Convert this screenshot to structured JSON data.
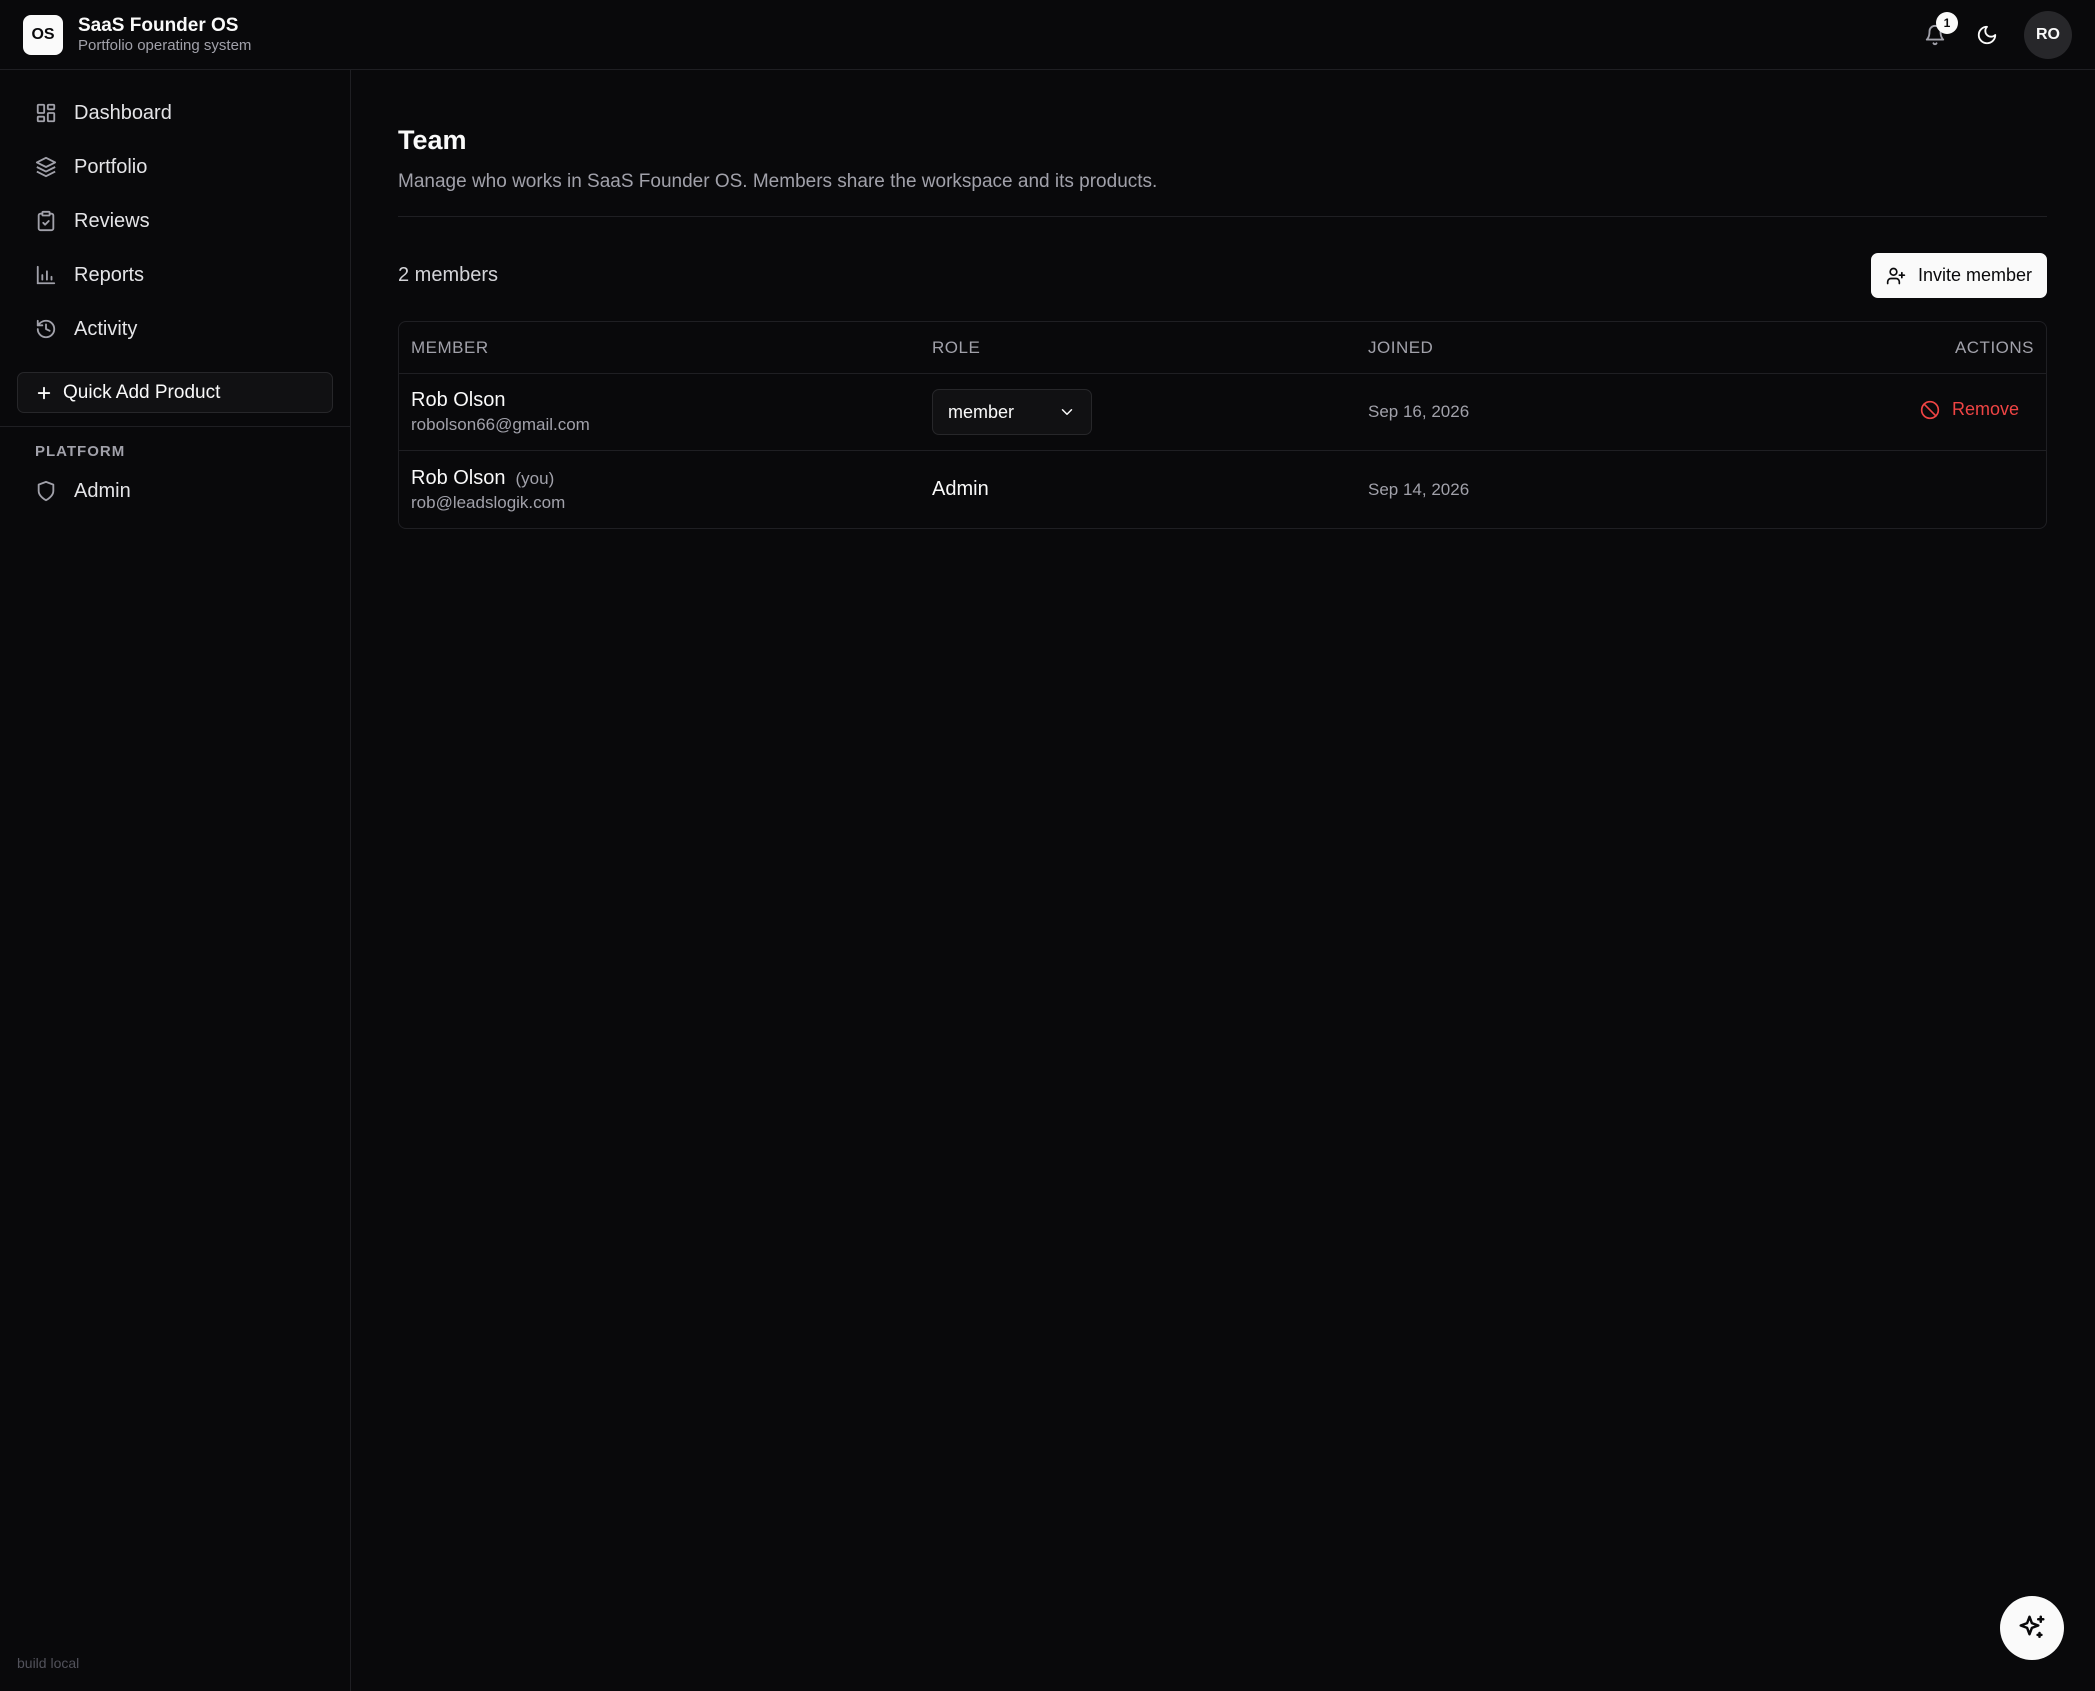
{
  "app": {
    "logo_text": "OS",
    "name": "SaaS Founder OS",
    "subtitle": "Portfolio operating system"
  },
  "header": {
    "notification_count": "1",
    "avatar_initials": "RO"
  },
  "sidebar": {
    "items": [
      {
        "label": "Dashboard",
        "icon": "dashboard-icon"
      },
      {
        "label": "Portfolio",
        "icon": "layers-icon"
      },
      {
        "label": "Reviews",
        "icon": "clipboard-check-icon"
      },
      {
        "label": "Reports",
        "icon": "bar-chart-icon"
      },
      {
        "label": "Activity",
        "icon": "history-icon"
      }
    ],
    "quick_add_label": "Quick Add Product",
    "section_label": "PLATFORM",
    "platform_items": [
      {
        "label": "Admin",
        "icon": "shield-icon"
      }
    ],
    "build_label": "build local"
  },
  "main": {
    "title": "Team",
    "description": "Manage who works in SaaS Founder OS. Members share the workspace and its products.",
    "member_count": "2 members",
    "invite_label": "Invite member",
    "table": {
      "headers": {
        "member": "MEMBER",
        "role": "ROLE",
        "joined": "JOINED",
        "actions": "ACTIONS"
      },
      "rows": [
        {
          "name": "Rob Olson",
          "you": "",
          "email": "robolson66@gmail.com",
          "role": "member",
          "joined": "Sep 16, 2026",
          "action": "Remove"
        },
        {
          "name": "Rob Olson",
          "you": "(you)",
          "email": "rob@leadslogik.com",
          "role": "Admin",
          "joined": "Sep 14, 2026",
          "action": ""
        }
      ]
    }
  },
  "colors": {
    "background": "#09090b",
    "danger": "#ef4444",
    "foreground": "#fafafa",
    "muted": "#a1a1aa"
  }
}
